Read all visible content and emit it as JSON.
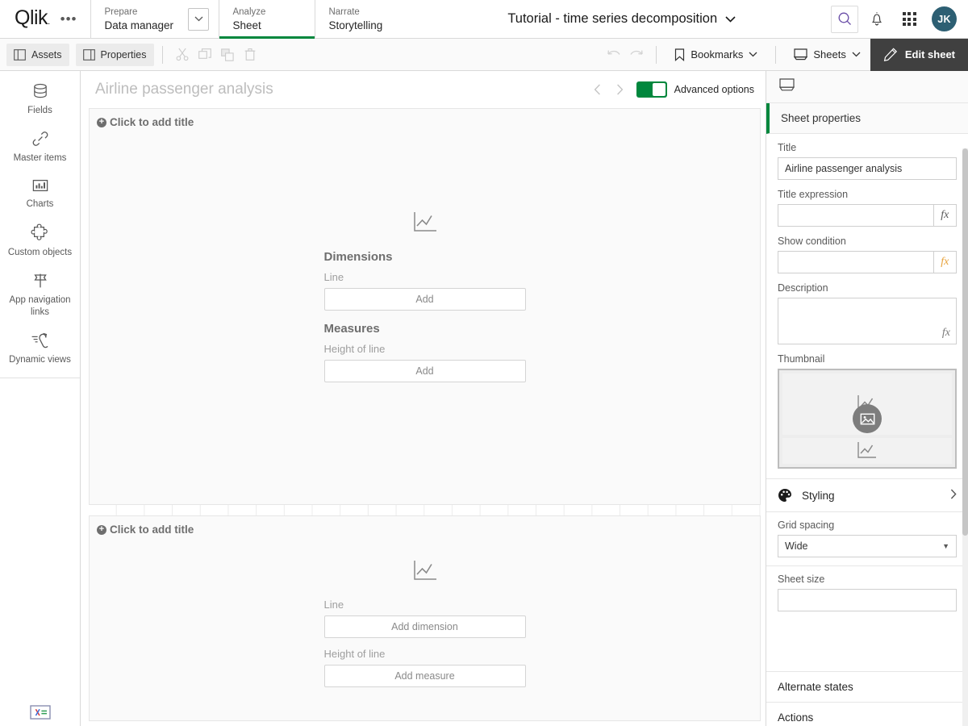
{
  "topbar": {
    "logo": "Qlik",
    "menu_icon": "•••",
    "sections": [
      {
        "kicker": "Prepare",
        "main": "Data manager"
      },
      {
        "kicker": "Analyze",
        "main": "Sheet"
      },
      {
        "kicker": "Narrate",
        "main": "Storytelling"
      }
    ],
    "app_title": "Tutorial - time series decomposition",
    "avatar_initials": "JK",
    "avatar_color": "#2d5f73",
    "accent_green": "#00873d"
  },
  "toolbar": {
    "assets_label": "Assets",
    "properties_label": "Properties",
    "cut_label": "Cut",
    "copy_label": "Copy",
    "paste_label": "Paste",
    "delete_label": "Delete",
    "undo_label": "Undo",
    "redo_label": "Redo",
    "bookmarks_label": "Bookmarks",
    "sheets_label": "Sheets",
    "edit_sheet_label": "Edit sheet"
  },
  "rail": {
    "items": [
      {
        "label": "Fields",
        "icon": "database-icon"
      },
      {
        "label": "Master items",
        "icon": "link-icon"
      },
      {
        "label": "Charts",
        "icon": "bar-chart-icon"
      },
      {
        "label": "Custom objects",
        "icon": "puzzle-icon"
      },
      {
        "label": "App navigation links",
        "icon": "flag-icon"
      },
      {
        "label": "Dynamic views",
        "icon": "dynamic-views-icon"
      }
    ],
    "bottom_icon": "expression-editor-icon"
  },
  "sheet": {
    "title": "Airline passenger analysis",
    "prev_label": "Previous sheet",
    "next_label": "Next sheet",
    "advanced_options_label": "Advanced options",
    "advanced_options_on": true,
    "objects": [
      {
        "title_placeholder": "Click to add title",
        "chart_icon": "line-chart-icon",
        "groups": [
          {
            "heading": "Dimensions",
            "field": "Line",
            "button": "Add"
          },
          {
            "heading": "Measures",
            "field": "Height of line",
            "button": "Add"
          }
        ]
      },
      {
        "title_placeholder": "Click to add title",
        "chart_icon": "line-chart-icon",
        "groups": [
          {
            "heading": "",
            "field": "Line",
            "button": "Add dimension"
          },
          {
            "heading": "",
            "field": "Height of line",
            "button": "Add measure"
          }
        ]
      }
    ]
  },
  "properties": {
    "tab_icon": "sheet-icon",
    "section_title": "Sheet properties",
    "title_label": "Title",
    "title_value": "Airline passenger analysis",
    "title_expression_label": "Title expression",
    "title_expression_value": "",
    "show_condition_label": "Show condition",
    "show_condition_value": "",
    "description_label": "Description",
    "description_value": "",
    "thumbnail_label": "Thumbnail",
    "fx_label": "fx",
    "styling_label": "Styling",
    "grid_spacing_label": "Grid spacing",
    "grid_spacing_value": "Wide",
    "sheet_size_label": "Sheet size",
    "alternate_states_label": "Alternate states",
    "actions_label": "Actions"
  }
}
